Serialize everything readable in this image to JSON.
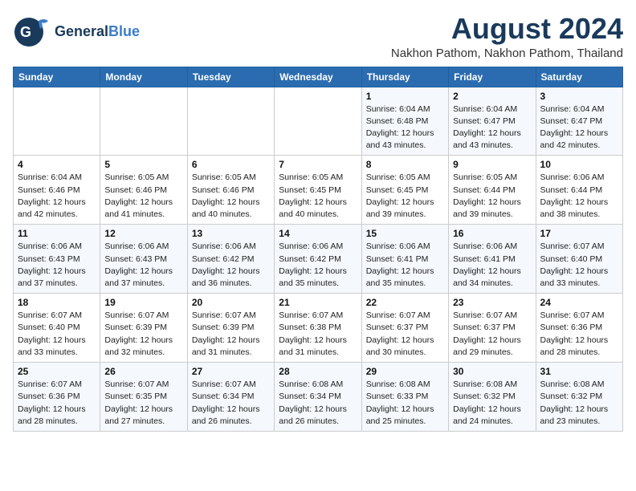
{
  "header": {
    "logo": "GeneralBlue",
    "month": "August 2024",
    "location": "Nakhon Pathom, Nakhon Pathom, Thailand"
  },
  "days_of_week": [
    "Sunday",
    "Monday",
    "Tuesday",
    "Wednesday",
    "Thursday",
    "Friday",
    "Saturday"
  ],
  "weeks": [
    [
      {
        "day": "",
        "info": ""
      },
      {
        "day": "",
        "info": ""
      },
      {
        "day": "",
        "info": ""
      },
      {
        "day": "",
        "info": ""
      },
      {
        "day": "1",
        "info": "Sunrise: 6:04 AM\nSunset: 6:48 PM\nDaylight: 12 hours\nand 43 minutes."
      },
      {
        "day": "2",
        "info": "Sunrise: 6:04 AM\nSunset: 6:47 PM\nDaylight: 12 hours\nand 43 minutes."
      },
      {
        "day": "3",
        "info": "Sunrise: 6:04 AM\nSunset: 6:47 PM\nDaylight: 12 hours\nand 42 minutes."
      }
    ],
    [
      {
        "day": "4",
        "info": "Sunrise: 6:04 AM\nSunset: 6:46 PM\nDaylight: 12 hours\nand 42 minutes."
      },
      {
        "day": "5",
        "info": "Sunrise: 6:05 AM\nSunset: 6:46 PM\nDaylight: 12 hours\nand 41 minutes."
      },
      {
        "day": "6",
        "info": "Sunrise: 6:05 AM\nSunset: 6:46 PM\nDaylight: 12 hours\nand 40 minutes."
      },
      {
        "day": "7",
        "info": "Sunrise: 6:05 AM\nSunset: 6:45 PM\nDaylight: 12 hours\nand 40 minutes."
      },
      {
        "day": "8",
        "info": "Sunrise: 6:05 AM\nSunset: 6:45 PM\nDaylight: 12 hours\nand 39 minutes."
      },
      {
        "day": "9",
        "info": "Sunrise: 6:05 AM\nSunset: 6:44 PM\nDaylight: 12 hours\nand 39 minutes."
      },
      {
        "day": "10",
        "info": "Sunrise: 6:06 AM\nSunset: 6:44 PM\nDaylight: 12 hours\nand 38 minutes."
      }
    ],
    [
      {
        "day": "11",
        "info": "Sunrise: 6:06 AM\nSunset: 6:43 PM\nDaylight: 12 hours\nand 37 minutes."
      },
      {
        "day": "12",
        "info": "Sunrise: 6:06 AM\nSunset: 6:43 PM\nDaylight: 12 hours\nand 37 minutes."
      },
      {
        "day": "13",
        "info": "Sunrise: 6:06 AM\nSunset: 6:42 PM\nDaylight: 12 hours\nand 36 minutes."
      },
      {
        "day": "14",
        "info": "Sunrise: 6:06 AM\nSunset: 6:42 PM\nDaylight: 12 hours\nand 35 minutes."
      },
      {
        "day": "15",
        "info": "Sunrise: 6:06 AM\nSunset: 6:41 PM\nDaylight: 12 hours\nand 35 minutes."
      },
      {
        "day": "16",
        "info": "Sunrise: 6:06 AM\nSunset: 6:41 PM\nDaylight: 12 hours\nand 34 minutes."
      },
      {
        "day": "17",
        "info": "Sunrise: 6:07 AM\nSunset: 6:40 PM\nDaylight: 12 hours\nand 33 minutes."
      }
    ],
    [
      {
        "day": "18",
        "info": "Sunrise: 6:07 AM\nSunset: 6:40 PM\nDaylight: 12 hours\nand 33 minutes."
      },
      {
        "day": "19",
        "info": "Sunrise: 6:07 AM\nSunset: 6:39 PM\nDaylight: 12 hours\nand 32 minutes."
      },
      {
        "day": "20",
        "info": "Sunrise: 6:07 AM\nSunset: 6:39 PM\nDaylight: 12 hours\nand 31 minutes."
      },
      {
        "day": "21",
        "info": "Sunrise: 6:07 AM\nSunset: 6:38 PM\nDaylight: 12 hours\nand 31 minutes."
      },
      {
        "day": "22",
        "info": "Sunrise: 6:07 AM\nSunset: 6:37 PM\nDaylight: 12 hours\nand 30 minutes."
      },
      {
        "day": "23",
        "info": "Sunrise: 6:07 AM\nSunset: 6:37 PM\nDaylight: 12 hours\nand 29 minutes."
      },
      {
        "day": "24",
        "info": "Sunrise: 6:07 AM\nSunset: 6:36 PM\nDaylight: 12 hours\nand 28 minutes."
      }
    ],
    [
      {
        "day": "25",
        "info": "Sunrise: 6:07 AM\nSunset: 6:36 PM\nDaylight: 12 hours\nand 28 minutes."
      },
      {
        "day": "26",
        "info": "Sunrise: 6:07 AM\nSunset: 6:35 PM\nDaylight: 12 hours\nand 27 minutes."
      },
      {
        "day": "27",
        "info": "Sunrise: 6:07 AM\nSunset: 6:34 PM\nDaylight: 12 hours\nand 26 minutes."
      },
      {
        "day": "28",
        "info": "Sunrise: 6:08 AM\nSunset: 6:34 PM\nDaylight: 12 hours\nand 26 minutes."
      },
      {
        "day": "29",
        "info": "Sunrise: 6:08 AM\nSunset: 6:33 PM\nDaylight: 12 hours\nand 25 minutes."
      },
      {
        "day": "30",
        "info": "Sunrise: 6:08 AM\nSunset: 6:32 PM\nDaylight: 12 hours\nand 24 minutes."
      },
      {
        "day": "31",
        "info": "Sunrise: 6:08 AM\nSunset: 6:32 PM\nDaylight: 12 hours\nand 23 minutes."
      }
    ]
  ]
}
